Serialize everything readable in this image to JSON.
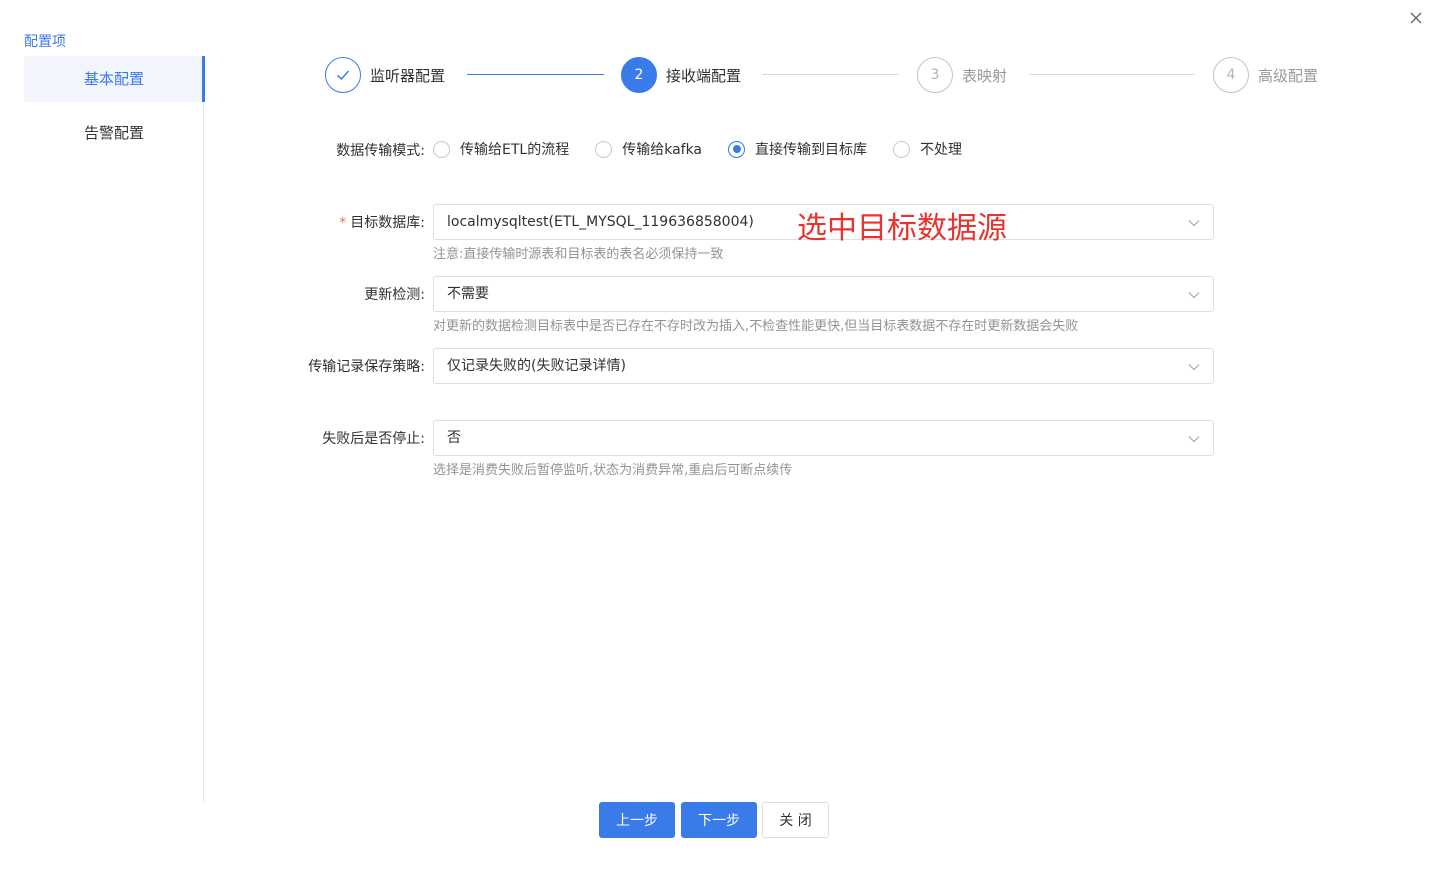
{
  "sidebar": {
    "title": "配置项",
    "items": [
      {
        "label": "基本配置",
        "active": true
      },
      {
        "label": "告警配置",
        "active": false
      }
    ]
  },
  "steps": [
    {
      "index": "1",
      "label": "监听器配置",
      "status": "done"
    },
    {
      "index": "2",
      "label": "接收端配置",
      "status": "current"
    },
    {
      "index": "3",
      "label": "表映射",
      "status": "wait"
    },
    {
      "index": "4",
      "label": "高级配置",
      "status": "wait"
    }
  ],
  "form": {
    "mode": {
      "label": "数据传输模式:",
      "options": [
        {
          "label": "传输给ETL的流程",
          "checked": false
        },
        {
          "label": "传输给kafka",
          "checked": false
        },
        {
          "label": "直接传输到目标库",
          "checked": true
        },
        {
          "label": "不处理",
          "checked": false
        }
      ]
    },
    "target_db": {
      "label": "目标数据库:",
      "required_mark": "*",
      "value": "localmysqltest(ETL_MYSQL_119636858004)",
      "hint": "注意:直接传输时源表和目标表的表名必须保持一致"
    },
    "update_check": {
      "label": "更新检测:",
      "value": "不需要",
      "hint": "对更新的数据检测目标表中是否已存在不存时改为插入,不检查性能更快,但当目标表数据不存在时更新数据会失败"
    },
    "record_policy": {
      "label": "传输记录保存策略:",
      "value": "仅记录失败的(失败记录详情)"
    },
    "stop_on_fail": {
      "label": "失败后是否停止:",
      "value": "否",
      "hint": "选择是消费失败后暂停监听,状态为消费异常,重启后可断点续传"
    }
  },
  "annotation": "选中目标数据源",
  "buttons": {
    "prev": "上一步",
    "next": "下一步",
    "close": "关 闭"
  },
  "colors": {
    "primary": "#3a7bea",
    "annotation": "#e8342f",
    "required": "#f56c6c"
  }
}
